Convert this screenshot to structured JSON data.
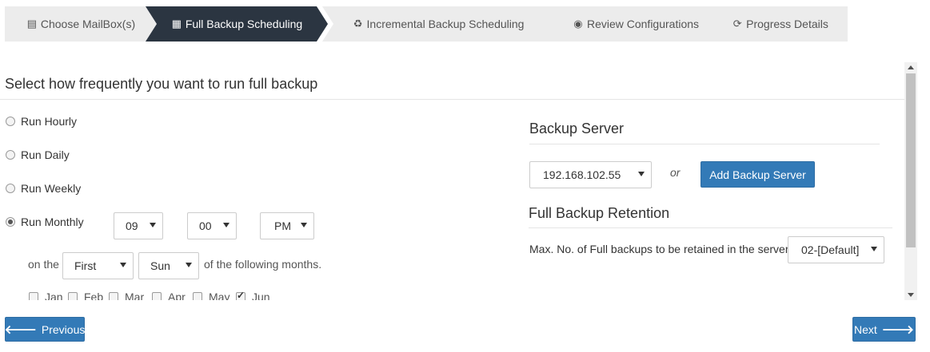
{
  "wizard": {
    "steps": [
      {
        "label": "Choose MailBox(s)",
        "icon": "file-icon",
        "glyph": "▤",
        "active": false
      },
      {
        "label": "Full Backup Scheduling",
        "icon": "calendar-icon",
        "glyph": "▦",
        "active": true
      },
      {
        "label": "Incremental Backup Scheduling",
        "icon": "recycle-icon",
        "glyph": "♻",
        "active": false
      },
      {
        "label": "Review Configurations",
        "icon": "eye-icon",
        "glyph": "◉",
        "active": false
      },
      {
        "label": "Progress Details",
        "icon": "refresh-icon",
        "glyph": "⟳",
        "active": false
      }
    ]
  },
  "schedule": {
    "title": "Select how frequently you want to run full backup",
    "options": [
      {
        "label": "Run Hourly",
        "checked": false
      },
      {
        "label": "Run Daily",
        "checked": false
      },
      {
        "label": "Run Weekly",
        "checked": false
      },
      {
        "label": "Run Monthly",
        "checked": true
      }
    ],
    "hour": "09",
    "minute": "00",
    "ampm": "PM",
    "on_the_label": "on the",
    "week_ordinal": "First",
    "weekday": "Sun",
    "following_months_label": "of the following months.",
    "months": [
      {
        "label": "Jan",
        "checked": false
      },
      {
        "label": "Feb",
        "checked": false
      },
      {
        "label": "Mar",
        "checked": false
      },
      {
        "label": "Apr",
        "checked": false
      },
      {
        "label": "May",
        "checked": false
      },
      {
        "label": "Jun",
        "checked": true
      }
    ]
  },
  "backup_server": {
    "heading": "Backup Server",
    "selected": "192.168.102.55",
    "or_label": "or",
    "add_button": "Add Backup Server"
  },
  "retention": {
    "heading": "Full Backup Retention",
    "label": "Max. No. of Full backups to be retained in the server",
    "selected": "02-[Default]"
  },
  "footer": {
    "previous_label": "Previous",
    "next_label": "Next"
  },
  "colors": {
    "active_step": "#2b3541",
    "step_bg": "#ececec",
    "primary_button": "#337ab7"
  }
}
